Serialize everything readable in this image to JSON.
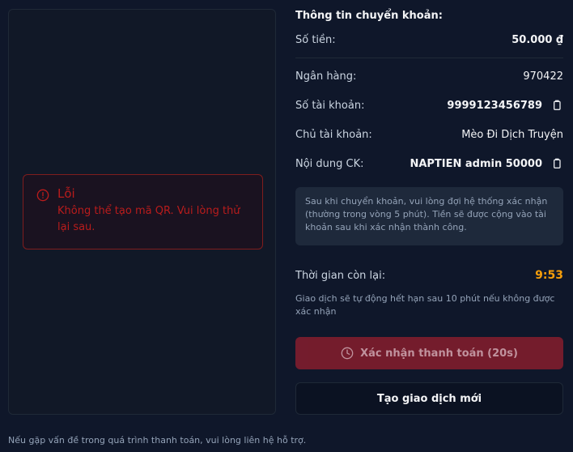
{
  "error": {
    "title": "Lỗi",
    "message": "Không thể tạo mã QR. Vui lòng thử lại sau."
  },
  "transfer": {
    "section_title": "Thông tin chuyển khoản:",
    "amount_label": "Số tiền:",
    "amount_value": "50.000 ₫",
    "bank_label": "Ngân hàng:",
    "bank_value": "970422",
    "account_number_label": "Số tài khoản:",
    "account_number_value": "9999123456789",
    "account_holder_label": "Chủ tài khoản:",
    "account_holder_value": "Mèo Đi Dịch Truyện",
    "content_label": "Nội dung CK:",
    "content_value": "NAPTIEN admin 50000"
  },
  "note": "Sau khi chuyển khoản, vui lòng đợi hệ thống xác nhận (thường trong vòng 5 phút). Tiền sẽ được cộng vào tài khoản sau khi xác nhận thành công.",
  "timer": {
    "label": "Thời gian còn lại:",
    "value": "9:53",
    "expiry_note": "Giao dịch sẽ tự động hết hạn sau 10 phút nếu không được xác nhận"
  },
  "buttons": {
    "confirm_label": "Xác nhận thanh toán (20s)",
    "new_transaction_label": "Tạo giao dịch mới"
  },
  "footer": "Nếu gặp vấn đề trong quá trình thanh toán, vui lòng liên hệ hỗ trợ.",
  "colors": {
    "background": "#0f172a",
    "error": "#b91c1c",
    "timer": "#f59e0b",
    "confirm_button": "#7f1d2d"
  },
  "icons": {
    "error": "alert-circle-icon",
    "copy": "copy-icon",
    "clock": "clock-icon"
  }
}
